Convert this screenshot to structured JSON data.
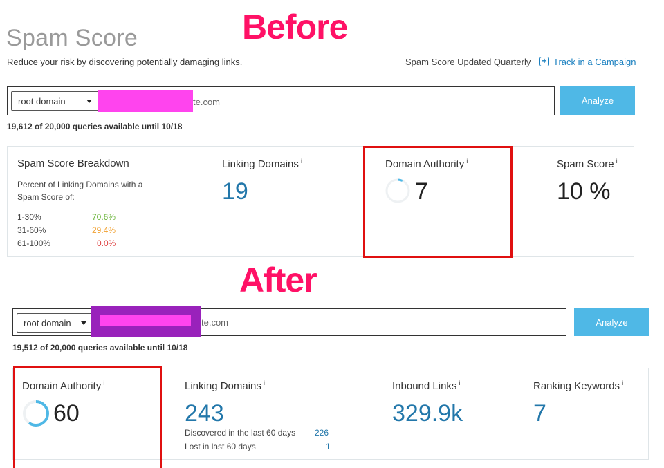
{
  "overlay": {
    "before": "Before",
    "after": "After"
  },
  "header": {
    "title": "Spam Score",
    "subtitle": "Reduce your risk by discovering potentially damaging links.",
    "updated": "Spam Score Updated Quarterly",
    "track_link": "Track in a Campaign"
  },
  "before": {
    "search": {
      "scope": "root domain",
      "domain_suffix": "te.com",
      "analyze": "Analyze"
    },
    "quota": "19,612 of 20,000 queries available until 10/18",
    "breakdown": {
      "title": "Spam Score Breakdown",
      "description": "Percent of Linking Domains with a Spam Score of:",
      "rows": [
        {
          "range": "1-30%",
          "value": "70.6%"
        },
        {
          "range": "31-60%",
          "value": "29.4%"
        },
        {
          "range": "61-100%",
          "value": "0.0%"
        }
      ]
    },
    "linking_domains": {
      "label": "Linking Domains",
      "info": "i",
      "value": "19"
    },
    "domain_authority": {
      "label": "Domain Authority",
      "info": "i",
      "value": "7",
      "ring_fraction": 0.07
    },
    "spam_score": {
      "label": "Spam Score",
      "info": "i",
      "value": "10 %"
    }
  },
  "after": {
    "search": {
      "scope": "root domain",
      "domain_suffix": "te.com",
      "analyze": "Analyze"
    },
    "quota": "19,512 of 20,000 queries available until 10/18",
    "domain_authority": {
      "label": "Domain Authority",
      "info": "i",
      "value": "60",
      "ring_fraction": 0.6
    },
    "linking_domains": {
      "label": "Linking Domains",
      "info": "i",
      "value": "243",
      "discovered_label": "Discovered in the last 60 days",
      "discovered_value": "226",
      "lost_label": "Lost in last 60 days",
      "lost_value": "1"
    },
    "inbound_links": {
      "label": "Inbound Links",
      "info": "i",
      "value": "329.9k"
    },
    "ranking_keywords": {
      "label": "Ranking Keywords",
      "info": "i",
      "value": "7"
    }
  },
  "colors": {
    "accent": "#2277aa",
    "button": "#4fb8e6",
    "highlight": "#e01010",
    "overlay": "#ff1166",
    "redact_pink": "#ff44ee",
    "redact_purple": "#9922bb"
  }
}
